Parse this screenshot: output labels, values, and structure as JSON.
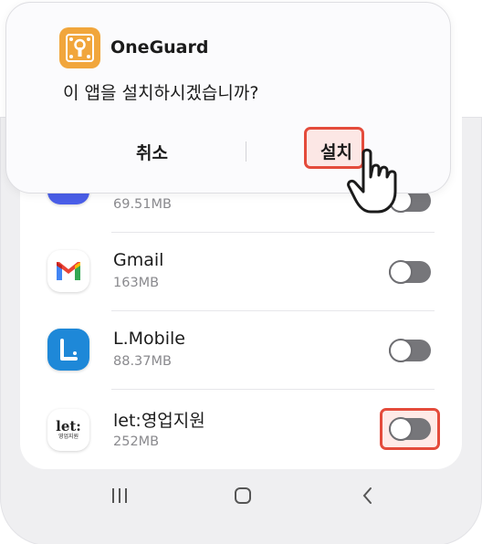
{
  "dialog": {
    "app_name": "OneGuard",
    "question": "이 앱을 설치하시겠습니까?",
    "cancel_label": "취소",
    "install_label": "설치"
  },
  "apps": [
    {
      "name": "",
      "size": "69.51MB",
      "icon": "blue-app-icon",
      "toggle_on": false
    },
    {
      "name": "Gmail",
      "size": "163MB",
      "icon": "gmail-icon",
      "toggle_on": false
    },
    {
      "name": "L.Mobile",
      "size": "88.37MB",
      "icon": "lmobile-icon",
      "toggle_on": false
    },
    {
      "name": "let:영업지원",
      "size": "252MB",
      "icon": "let-icon",
      "icon_text": "let:",
      "icon_subtext": "영업지원",
      "toggle_on": false
    }
  ],
  "nav": {
    "recent_icon": "recent-apps-icon",
    "home_icon": "home-icon",
    "back_icon": "back-icon"
  },
  "colors": {
    "highlight": "#e44b3b",
    "oneguard_icon": "#f1a63c",
    "lmobile": "#1e88d8"
  }
}
